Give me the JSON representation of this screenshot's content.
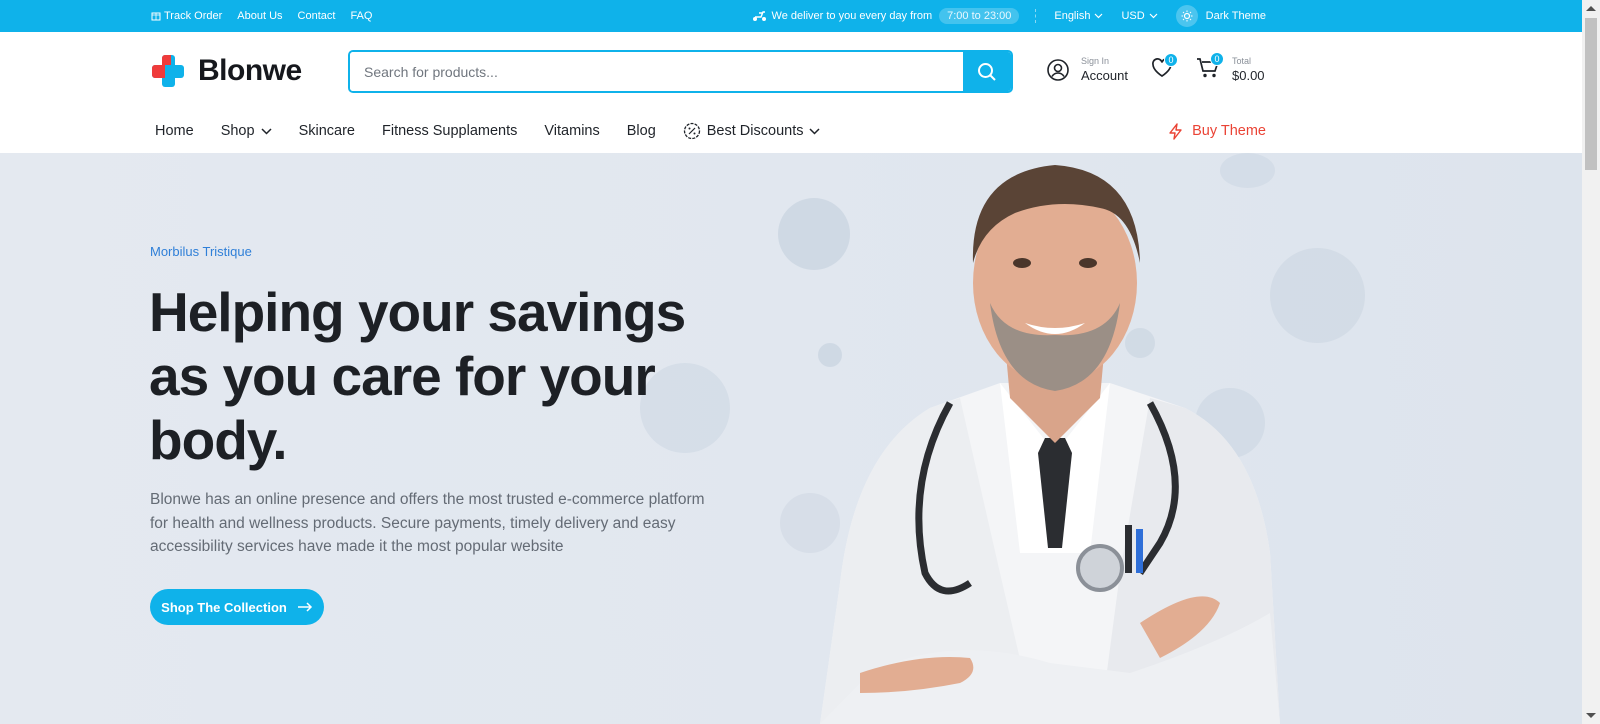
{
  "topbar": {
    "links": [
      "Track Order",
      "About Us",
      "Contact",
      "FAQ"
    ],
    "delivery_text": "We deliver to you every day from",
    "delivery_hours": "7:00 to 23:00",
    "language": "English",
    "currency": "USD",
    "theme_label": "Dark Theme"
  },
  "header": {
    "logo_text": "Blonwe",
    "search_placeholder": "Search for products...",
    "account_small": "Sign In",
    "account_big": "Account",
    "wishlist_count": "0",
    "cart_count": "0",
    "cart_small": "Total",
    "cart_total": "$0.00"
  },
  "nav": {
    "items": [
      "Home",
      "Shop",
      "Skincare",
      "Fitness Supplaments",
      "Vitamins",
      "Blog",
      "Best Discounts"
    ],
    "buy_label": "Buy Theme"
  },
  "hero": {
    "eyebrow": "Morbilus Tristique",
    "headline": "Helping your savings as you care for your body.",
    "description": "Blonwe has an online presence and offers the most trusted e-commerce platform for health and wellness products. Secure payments, timely delivery and easy accessibility services have made it the most popular website",
    "cta_label": "Shop The Collection"
  },
  "colors": {
    "accent": "#0fb2ea",
    "brand_red": "#ea4335",
    "eyebrow_blue": "#2f7fd8"
  }
}
